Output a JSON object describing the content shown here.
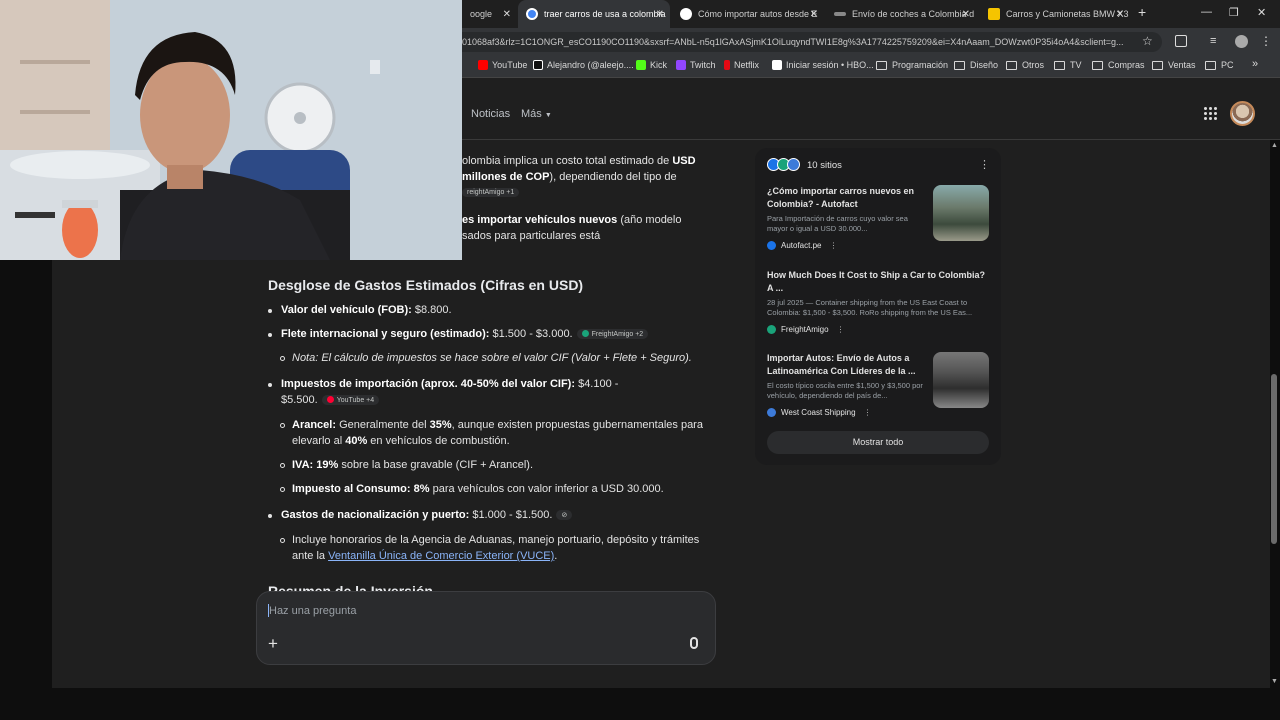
{
  "browser": {
    "tabs": [
      {
        "label": "oogle",
        "active": false
      },
      {
        "label": "traer carros de usa a colombia",
        "active": true
      },
      {
        "label": "Cómo importar autos desde E",
        "active": false
      },
      {
        "label": "Envío de coches a Colombia d",
        "active": false
      },
      {
        "label": "Carros y Camionetas BMW X3",
        "active": false
      }
    ],
    "new_tab": "+",
    "url": "01068af3&rlz=1C1ONGR_esCO1190CO1190&sxsrf=ANbL-n5q1lGAxASjmK1OiLuqyndTWI1E8g%3A1774225759209&ei=X4nAaam_DOWzwt0P35i4oA4&sclient=g...",
    "bookmarks": [
      "YouTube",
      "Alejandro (@aleejo....",
      "Kick",
      "Twitch",
      "Netflix",
      "Iniciar sesión • HBO...",
      "Programación",
      "Diseño",
      "Otros",
      "TV",
      "Compras",
      "Ventas",
      "PC"
    ],
    "more_bookmarks": "»"
  },
  "header": {
    "nav": [
      "Noticias",
      "Más"
    ]
  },
  "answer": {
    "intro_line1_a": "olombia implica un costo total estimado de ",
    "intro_line1_b": "USD",
    "intro_line2_a": " millones de COP",
    "intro_line2_b": "), dependiendo del tipo de",
    "intro_chip": "reightAmigo +1",
    "intro_line3_a": "es importar vehículos nuevos",
    "intro_line3_b": " (año modelo",
    "intro_line4": "sados para particulares está",
    "section_title": "Desglose de Gastos Estimados (Cifras en USD)",
    "items": [
      {
        "label": "Valor del vehículo (FOB):",
        "value": " $8.800."
      },
      {
        "label": "Flete internacional y seguro (estimado):",
        "value": " $1.500 - $3.000.",
        "chip": "FreightAmigo +2"
      },
      {
        "label": "Impuestos de importación (aprox. 40-50% del valor CIF):",
        "value": " $4.100 -",
        "value2": "$5.500.",
        "chip": "YouTube +4"
      },
      {
        "label": "Gastos de nacionalización y puerto:",
        "value": " $1.000 - $1.500."
      }
    ],
    "note": "Nota: El cálculo de impuestos se hace sobre el valor CIF (Valor + Flete + Seguro).",
    "sub_arancel_a": "Arancel:",
    "sub_arancel_b": " Generalmente del ",
    "sub_arancel_c": "35%",
    "sub_arancel_d": ", aunque existen propuestas gubernamentales para",
    "sub_arancel_e": "elevarlo al ",
    "sub_arancel_f": "40%",
    "sub_arancel_g": " en vehículos de combustión.",
    "sub_iva_a": "IVA: 19%",
    "sub_iva_b": " sobre la base gravable (CIF + Arancel).",
    "sub_consumo_a": "Impuesto al Consumo: 8%",
    "sub_consumo_b": " para vehículos con valor inferior a USD 30.000.",
    "sub_nac_a": "Incluye honorarios de la Agencia de Aduanas, manejo portuario, depósito y trámites",
    "sub_nac_b": "ante la ",
    "sub_nac_link": "Ventanilla Única de Comercio Exterior (VUCE)",
    "sub_nac_c": ".",
    "next_section": "Resumen de la Inversión"
  },
  "sources": {
    "count_label": "10 sitios",
    "items": [
      {
        "title": "¿Cómo importar carros nuevos en Colombia? - Autofact",
        "snippet": "Para Importación de carros cuyo valor sea mayor o igual a USD 30.000...",
        "site": "Autofact.pe"
      },
      {
        "title": "How Much Does It Cost to Ship a Car to Colombia? A ...",
        "snippet": "28 jul 2025 — Container shipping from the US East Coast to Colombia: $1,500 - $3,500. RoRo shipping from the US Eas...",
        "site": "FreightAmigo"
      },
      {
        "title": "Importar Autos: Envío de Autos a Latinoamérica Con Líderes de la ...",
        "snippet": "El costo típico oscila entre $1,500 y $3,500 por vehículo, dependiendo del país de...",
        "site": "West Coast Shipping"
      }
    ],
    "show_all": "Mostrar todo"
  },
  "ask": {
    "placeholder": "Haz una pregunta",
    "plus": "+"
  }
}
